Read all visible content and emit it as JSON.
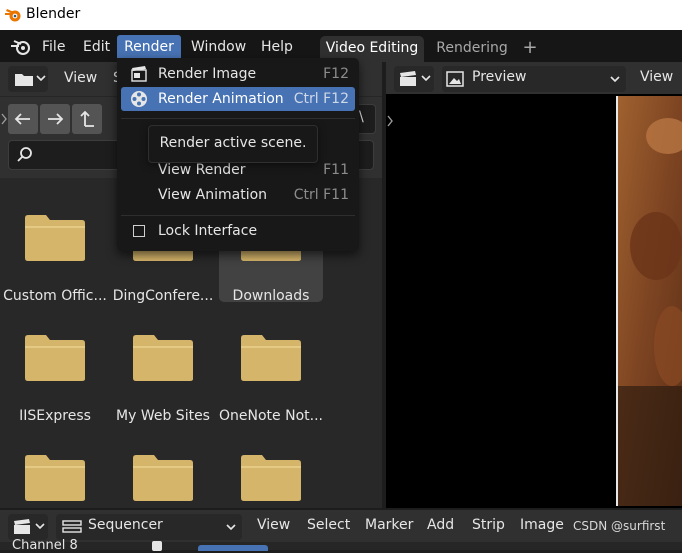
{
  "window": {
    "title": "Blender",
    "icon": "blender-logo-icon"
  },
  "topbar": {
    "menus": [
      "File",
      "Edit",
      "Render",
      "Window",
      "Help"
    ],
    "active_menu": "Render",
    "workspace_tabs": [
      "Video Editing",
      "Rendering"
    ],
    "active_tab": "Video Editing",
    "add_tab": "+"
  },
  "render_menu": {
    "items": [
      {
        "label": "Render Image",
        "shortcut": "F12",
        "icon": "render-image-icon"
      },
      {
        "label": "Render Animation",
        "shortcut": "Ctrl F12",
        "icon": "render-animation-icon",
        "highlighted": true
      },
      {
        "label": "View Render",
        "shortcut": "F11"
      },
      {
        "label": "View Animation",
        "shortcut": "Ctrl F11"
      },
      {
        "label": "Lock Interface",
        "shortcut": "",
        "checkbox": true,
        "checked": false
      }
    ],
    "tooltip": "Render active scene."
  },
  "file_browser": {
    "header_view": "View",
    "header_cut": "S",
    "path_fragment": "\\",
    "folders": [
      {
        "name": "Custom Offic..."
      },
      {
        "name": "DingConfere..."
      },
      {
        "name": "Downloads",
        "selected": true
      },
      {
        "name": "IISExpress"
      },
      {
        "name": "My Web Sites"
      },
      {
        "name": "OneNote Not..."
      },
      {
        "name": ""
      },
      {
        "name": ""
      },
      {
        "name": ""
      }
    ],
    "folder_color": "#d5b56a"
  },
  "preview_panel": {
    "mode": "Preview",
    "view": "View"
  },
  "sequencer_bar": {
    "editor": "Sequencer",
    "menus": [
      "View",
      "Select",
      "Marker",
      "Add",
      "Strip",
      "Image"
    ],
    "channel_label": "Channel 8"
  },
  "watermark": "CSDN @surfirst",
  "colors": {
    "accent": "#4772b3",
    "panel": "#303030",
    "background": "#1d1d1d"
  }
}
